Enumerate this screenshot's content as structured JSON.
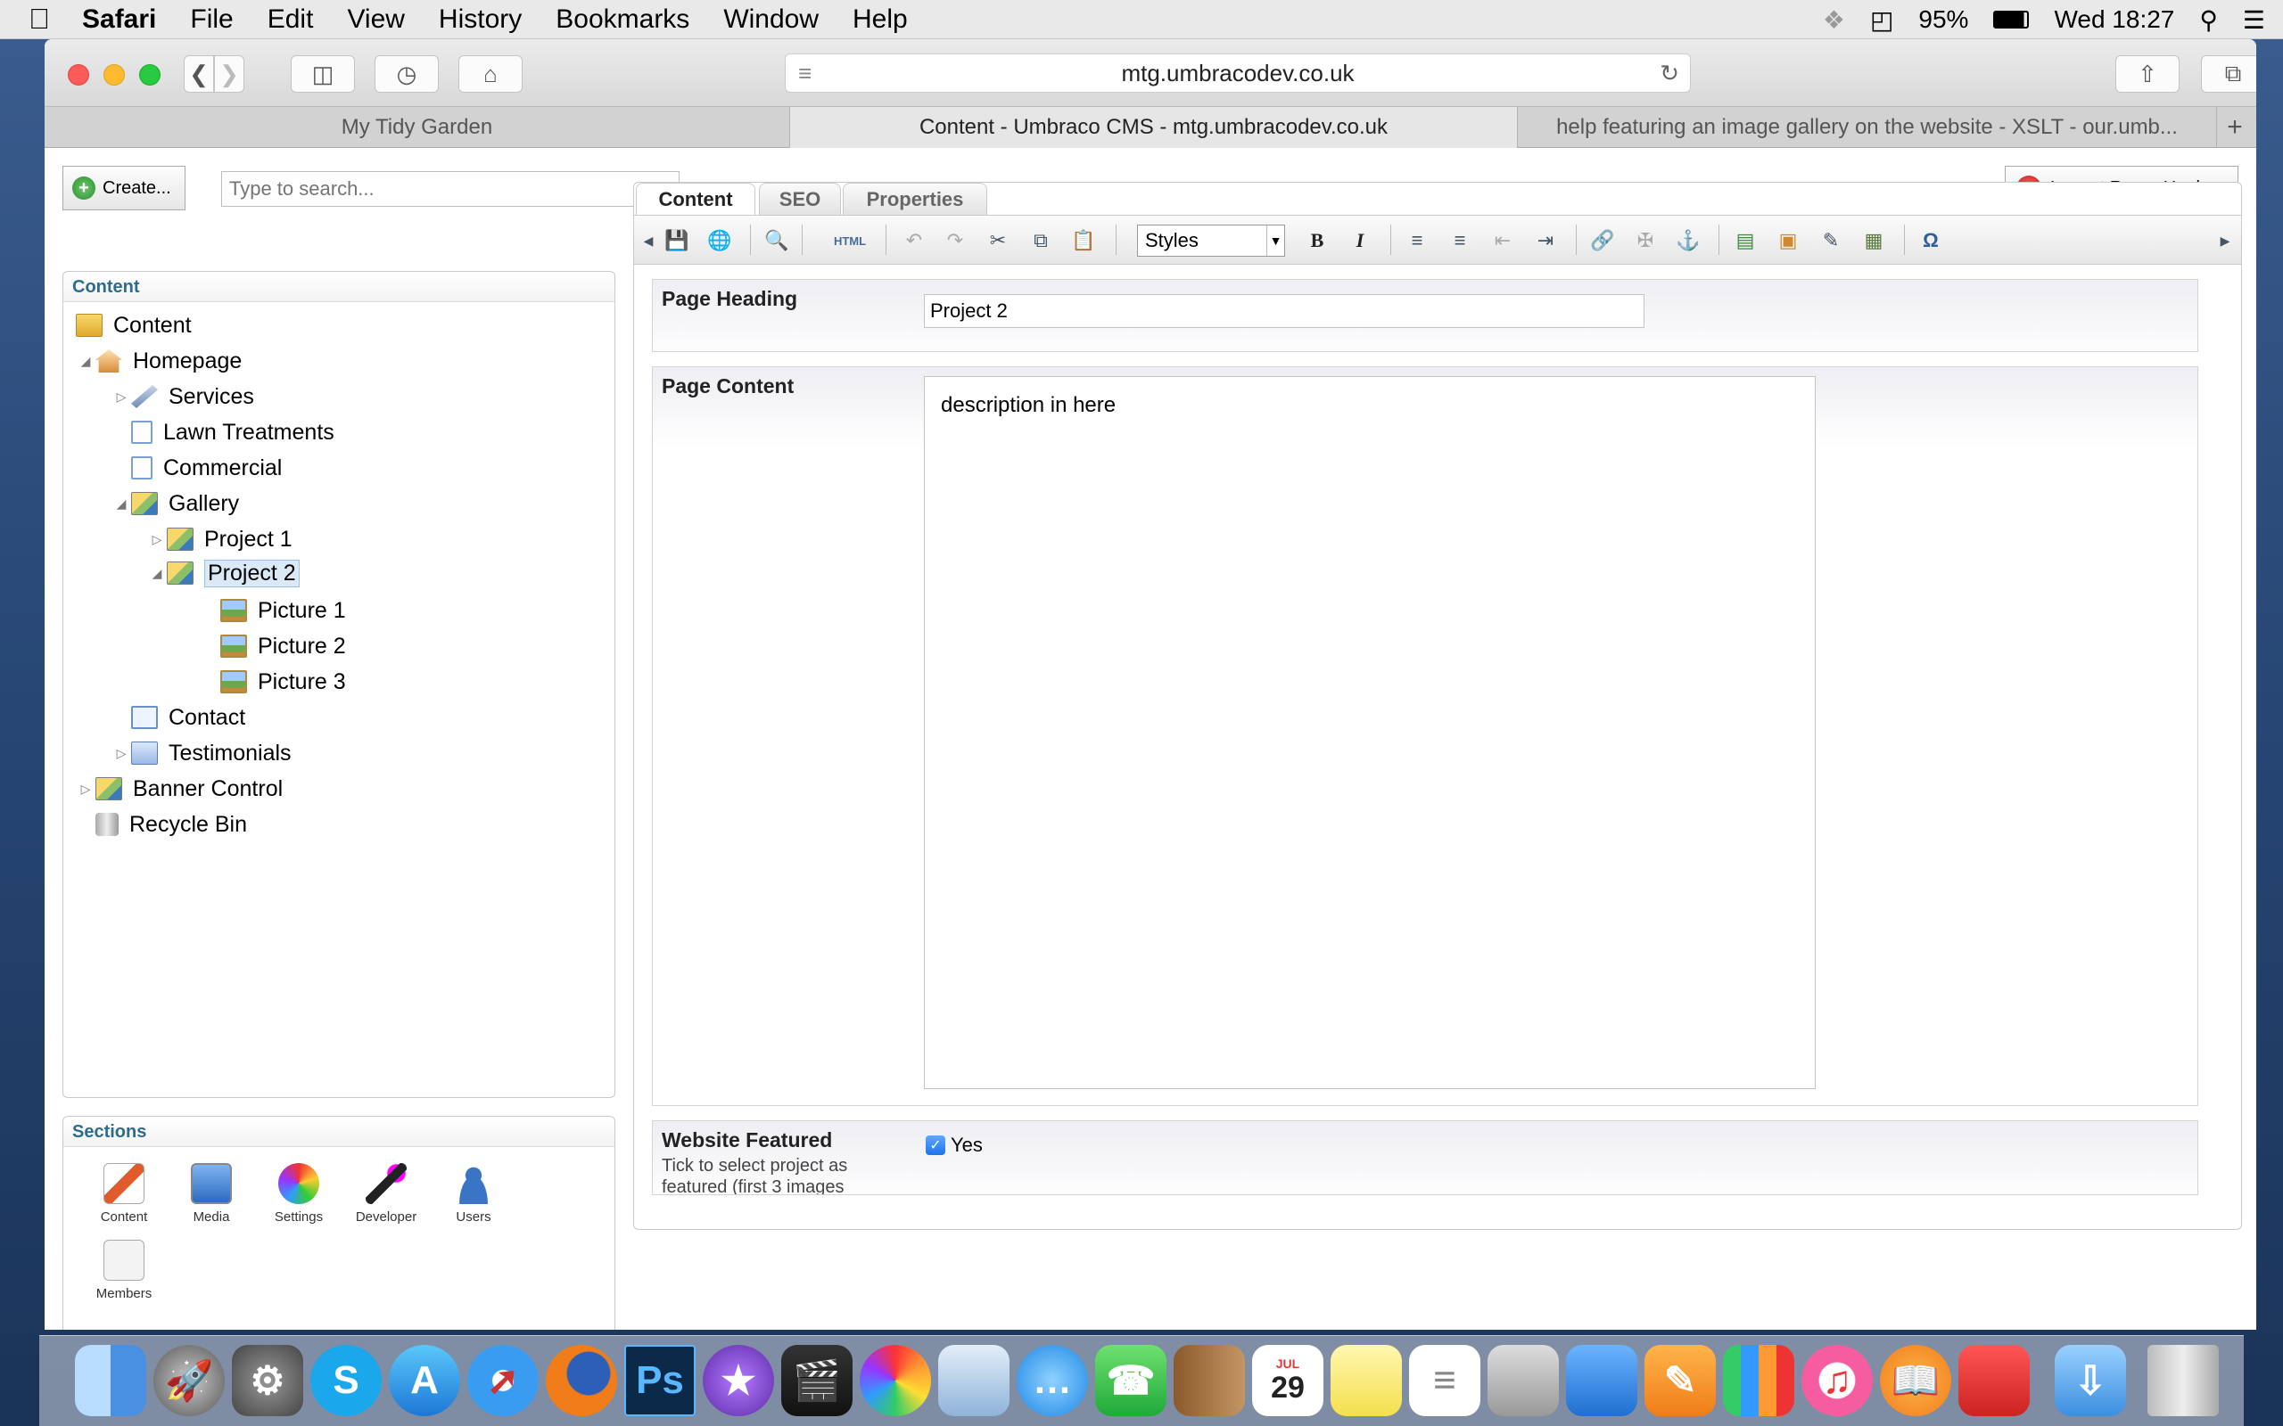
{
  "menubar": {
    "app": "Safari",
    "items": [
      "File",
      "Edit",
      "View",
      "History",
      "Bookmarks",
      "Window",
      "Help"
    ],
    "battery": "95%",
    "clock": "Wed 18:27"
  },
  "browser": {
    "url": "mtg.umbracodev.co.uk",
    "tabs": [
      {
        "title": "My Tidy Garden",
        "active": false
      },
      {
        "title": "Content - Umbraco CMS - mtg.umbracodev.co.uk",
        "active": true
      },
      {
        "title": "help featuring an image gallery on the website - XSLT - our.umb...",
        "active": false
      }
    ],
    "new_tab": "+"
  },
  "cms": {
    "create_label": "Create...",
    "search_placeholder": "Type to search...",
    "logout_label": "Logout:Roger Hughes",
    "tree": {
      "header": "Content",
      "items": [
        {
          "label": "Content",
          "icon": "folder-icon"
        },
        {
          "label": "Homepage",
          "icon": "home-icon"
        },
        {
          "label": "Services",
          "icon": "tools-icon"
        },
        {
          "label": "Lawn Treatments",
          "icon": "document-icon"
        },
        {
          "label": "Commercial",
          "icon": "document-icon"
        },
        {
          "label": "Gallery",
          "icon": "gallery-icon"
        },
        {
          "label": "Project 1",
          "icon": "gallery-icon"
        },
        {
          "label": "Project 2",
          "icon": "gallery-icon",
          "selected": true
        },
        {
          "label": "Picture 1",
          "icon": "picture-icon"
        },
        {
          "label": "Picture 2",
          "icon": "picture-icon"
        },
        {
          "label": "Picture 3",
          "icon": "picture-icon"
        },
        {
          "label": "Contact",
          "icon": "mail-icon"
        },
        {
          "label": "Testimonials",
          "icon": "stack-icon"
        },
        {
          "label": "Banner Control",
          "icon": "gallery-icon"
        },
        {
          "label": "Recycle Bin",
          "icon": "recycle-bin-icon"
        }
      ]
    },
    "sections": {
      "header": "Sections",
      "items": [
        "Content",
        "Media",
        "Settings",
        "Developer",
        "Users",
        "Members"
      ]
    },
    "editor": {
      "tabs": [
        "Content",
        "SEO",
        "Properties"
      ],
      "styles_value": "Styles",
      "html_button": "HTML",
      "page_heading_label": "Page Heading",
      "page_heading_value": "Project 2",
      "page_content_label": "Page Content",
      "page_content_value": "description in here",
      "featured_label": "Website Featured",
      "featured_desc": "Tick to select project as featured (first 3 images",
      "featured_checked": true,
      "featured_option": "Yes"
    }
  },
  "dock": {
    "apps": [
      "Finder",
      "Launchpad",
      "System Preferences",
      "Skype",
      "App Store",
      "Safari",
      "Firefox",
      "Photoshop",
      "iMovie",
      "Final Cut Pro",
      "Photos",
      "Preview",
      "Messages",
      "FaceTime",
      "Contacts",
      "Calendar",
      "Notes",
      "Reminders",
      "Photo Booth",
      "Keynote",
      "Pages",
      "Numbers",
      "iTunes",
      "iBooks",
      "Remote Desktop",
      "Downloads",
      "Trash"
    ],
    "calendar_month": "JUL",
    "calendar_day": "29",
    "photoshop_label": "Ps",
    "skype_label": "S"
  },
  "colors": {
    "accent": "#2e6c8d",
    "selection": "#dbe9f7"
  }
}
